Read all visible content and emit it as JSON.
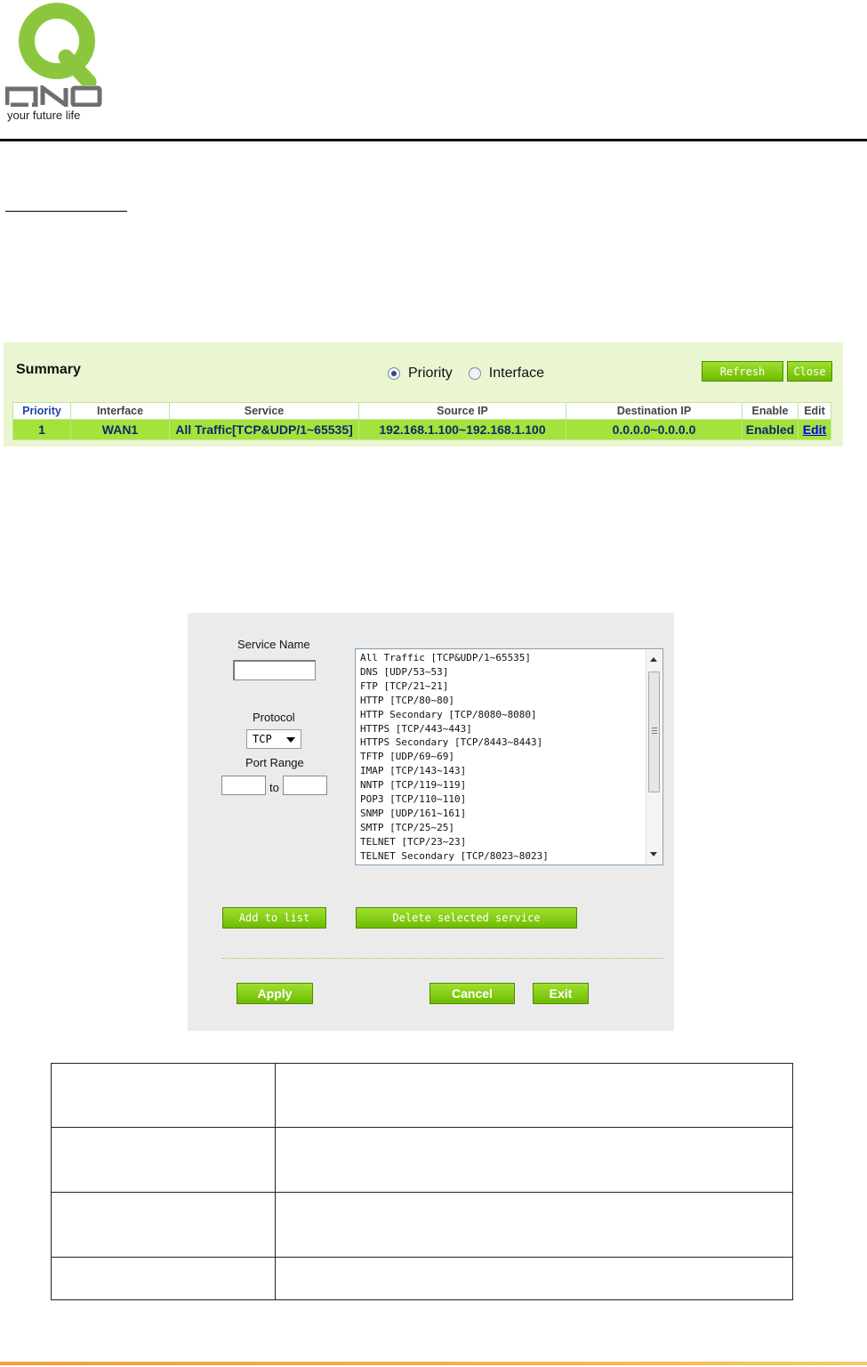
{
  "brand": {
    "tagline": "your future life",
    "colors": {
      "logo_green": "#8cc63f",
      "logo_gray": "#6d6e71",
      "accent_green": "#80c81a"
    }
  },
  "summary": {
    "title": "Summary",
    "view_options": [
      {
        "label": "Priority",
        "checked": true
      },
      {
        "label": "Interface",
        "checked": false
      }
    ],
    "buttons": {
      "refresh": "Refresh",
      "close": "Close"
    },
    "columns": [
      "Priority",
      "Interface",
      "Service",
      "Source IP",
      "Destination IP",
      "Enable",
      "Edit"
    ],
    "rows": [
      {
        "priority": "1",
        "interface": "WAN1",
        "service": "All Traffic[TCP&UDP/1~65535]",
        "source_ip": "192.168.1.100~192.168.1.100",
        "destination_ip": "0.0.0.0~0.0.0.0",
        "enable": "Enabled",
        "edit": "Edit"
      }
    ]
  },
  "service_form": {
    "service_name_label": "Service Name",
    "service_name_value": "",
    "protocol_label": "Protocol",
    "protocol_value": "TCP",
    "port_range_label": "Port Range",
    "port_range_to": "to",
    "port_from_value": "",
    "port_to_value": "",
    "services": [
      "All Traffic [TCP&UDP/1~65535]",
      "DNS [UDP/53~53]",
      "FTP [TCP/21~21]",
      "HTTP [TCP/80~80]",
      "HTTP Secondary [TCP/8080~8080]",
      "HTTPS [TCP/443~443]",
      "HTTPS Secondary [TCP/8443~8443]",
      "TFTP [UDP/69~69]",
      "IMAP [TCP/143~143]",
      "NNTP [TCP/119~119]",
      "POP3 [TCP/110~110]",
      "SNMP [UDP/161~161]",
      "SMTP [TCP/25~25]",
      "TELNET [TCP/23~23]",
      "TELNET Secondary [TCP/8023~8023]"
    ],
    "buttons": {
      "add": "Add to list",
      "delete": "Delete selected service",
      "apply": "Apply",
      "cancel": "Cancel",
      "exit": "Exit"
    }
  }
}
